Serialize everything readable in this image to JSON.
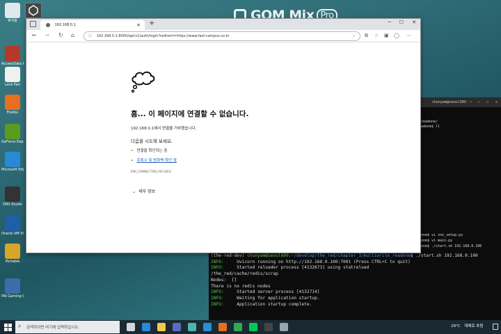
{
  "watermark": {
    "brand": "GOM Mix",
    "suffix": "Pro"
  },
  "desktop": {
    "icons": [
      {
        "label": "휴지통",
        "name": "recycle-bin-icon",
        "color": "#dfe8ee"
      },
      {
        "label": "AccessData FTK Imager",
        "name": "ftk-imager-icon",
        "color": "#b33a2a"
      },
      {
        "label": "Lock Pen",
        "name": "lock-icon",
        "color": "#f0f0f0"
      },
      {
        "label": "Firefox",
        "name": "firefox-icon",
        "color": "#e76f1f"
      },
      {
        "label": "GeForce Experience",
        "name": "nvidia-icon",
        "color": "#5a9c1e"
      },
      {
        "label": "Microsoft Edge",
        "name": "edge-icon",
        "color": "#2a89d4"
      },
      {
        "label": "OBS Studio",
        "name": "obs-icon",
        "color": "#333"
      },
      {
        "label": "Oracle VM VirtualBox",
        "name": "virtualbox-icon",
        "color": "#1f5ea8"
      },
      {
        "label": "Portable",
        "name": "portable-icon",
        "color": "#d9a42a"
      },
      {
        "label": "PAI Gaming Center",
        "name": "gaming-icon",
        "color": "#3b6ea8"
      }
    ],
    "unity_label": "Unity"
  },
  "browser": {
    "tab_title": "192.168.0.1",
    "tab_close": "×",
    "new_tab": "+",
    "url": "192.168.0.1:8000/api/v1/auth/login?redirect=https://www.fast-campus.co.kr",
    "error": {
      "heading": "흠... 이 페이지에 연결할 수 없습니다.",
      "message": "192.168.0.1에서 연결을 거부했습니다.",
      "try_title": "다음을 시도해 보세요.",
      "suggestions": [
        "연결을 확인하는 중",
        "프록시 및 방화벽 확인 중"
      ],
      "code": "ERR_CONNECTION_REFUSED",
      "details": "세부 정보"
    }
  },
  "terminal_right": {
    "title": "chunyam@seoul300: ~",
    "lines": [
      "",
      "",
      "readone/",
      "adone$ ll",
      "",
      "",
      "",
      "",
      "",
      "",
      "",
      "",
      "",
      "",
      "",
      "",
      "",
      "",
      "",
      "",
      "",
      "",
      "",
      "one$ vi zoo_setup.py",
      "one$ vi main.py",
      "one$ ./start.sh 192.168.0.100"
    ]
  },
  "terminal_bottom": {
    "lines": [
      {
        "parts": [
          {
            "t": "(the-red-dev) ",
            "c": "#dddddd"
          },
          {
            "t": "chunyam@seoul600",
            "c": "#7ed957"
          },
          {
            "t": ":",
            "c": "#dddddd"
          },
          {
            "t": "~/develop/the_red/chapter_3/multiwrite_readone",
            "c": "#6aa9ff"
          },
          {
            "t": "$ ./start.sh 192.168.0.100",
            "c": "#dddddd"
          }
        ]
      },
      {
        "parts": [
          {
            "t": "INFO:",
            "c": "#4ec94e"
          },
          {
            "t": "     Uvicorn running on http://192.168.0.100:7001 (Press CTRL+C to quit)",
            "c": "#dddddd"
          }
        ]
      },
      {
        "parts": [
          {
            "t": "INFO:",
            "c": "#4ec94e"
          },
          {
            "t": "     Started reloader process [4132673] using statreload",
            "c": "#dddddd"
          }
        ]
      },
      {
        "parts": [
          {
            "t": "/the_red/cache/redis/scrap",
            "c": "#dddddd"
          }
        ]
      },
      {
        "parts": [
          {
            "t": "Nodes:  []",
            "c": "#dddddd"
          }
        ]
      },
      {
        "parts": [
          {
            "t": "There is no redis nodes",
            "c": "#dddddd"
          }
        ]
      },
      {
        "parts": [
          {
            "t": "INFO:",
            "c": "#4ec94e"
          },
          {
            "t": "     Started server process [4132714]",
            "c": "#dddddd"
          }
        ]
      },
      {
        "parts": [
          {
            "t": "INFO:",
            "c": "#4ec94e"
          },
          {
            "t": "     Waiting for application startup.",
            "c": "#dddddd"
          }
        ]
      },
      {
        "parts": [
          {
            "t": "INFO:",
            "c": "#4ec94e"
          },
          {
            "t": "     Application startup complete.",
            "c": "#dddddd"
          }
        ]
      }
    ]
  },
  "taskbar": {
    "search_placeholder": "검색하려면 여기에 입력하십시오.",
    "weather": "29°C",
    "tray_text": "대체로 흐림",
    "apps": [
      "task-view-icon",
      "edge-icon",
      "explorer-icon",
      "store-icon",
      "photos-icon",
      "vscode-icon",
      "firefox-icon",
      "chrome-icon",
      "line-icon",
      "terminal-icon",
      "settings-icon"
    ]
  }
}
